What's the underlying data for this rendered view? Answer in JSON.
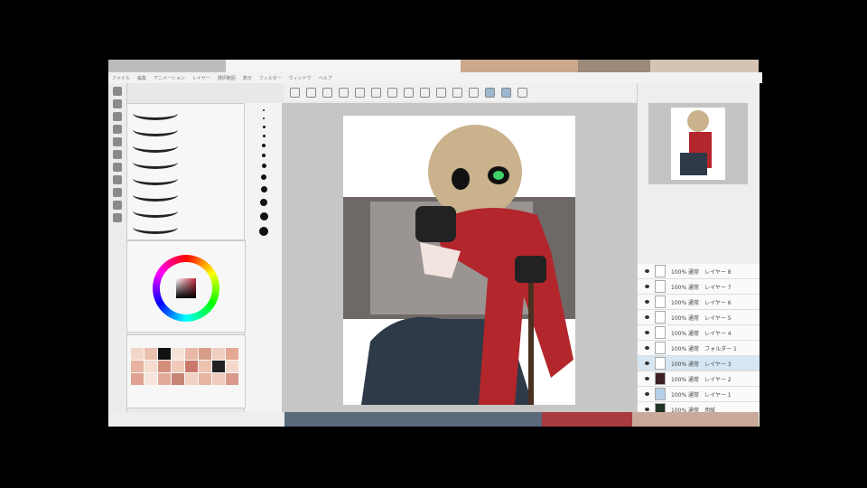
{
  "menu": [
    "ファイル",
    "編集",
    "アニメーション",
    "レイヤー",
    "選択範囲",
    "表示",
    "フィルター",
    "ウィンドウ",
    "ヘルプ"
  ],
  "layers": [
    {
      "blend": "100% 通常",
      "name": "レイヤー 8"
    },
    {
      "blend": "100% 通常",
      "name": "レイヤー 7"
    },
    {
      "blend": "100% 通常",
      "name": "レイヤー 6"
    },
    {
      "blend": "100% 通常",
      "name": "レイヤー 5"
    },
    {
      "blend": "100% 通常",
      "name": "レイヤー 4"
    },
    {
      "blend": "100% 通常",
      "name": "フォルダー 1"
    },
    {
      "blend": "100% 通常",
      "name": "レイヤー 3"
    },
    {
      "blend": "100% 通常",
      "name": "レイヤー 2"
    },
    {
      "blend": "100% 通常",
      "name": "レイヤー 1"
    },
    {
      "blend": "100% 通常",
      "name": "用紙"
    }
  ],
  "colors": {
    "scarf": "#b3262c",
    "overalls": "#2e3a48",
    "head": "#c9b28c",
    "eye": "#3fd06a"
  }
}
